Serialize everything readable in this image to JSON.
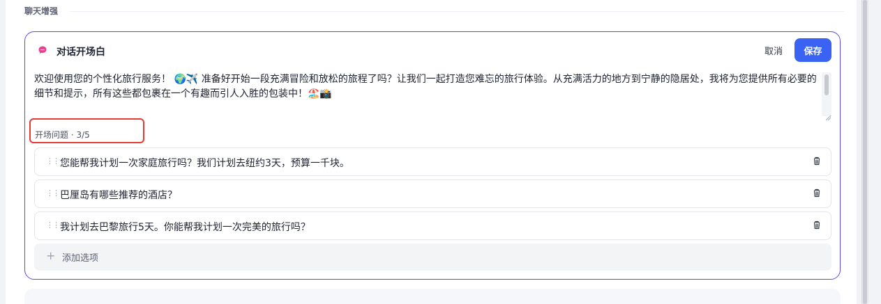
{
  "section": {
    "title": "聊天增强"
  },
  "card": {
    "title": "对话开场白",
    "cancel_label": "取消",
    "save_label": "保存",
    "intro_text": "欢迎使用您的个性化旅行服务！ 🌍✈️ 准备好开始一段充满冒险和放松的旅程了吗？让我们一起打造您难忘的旅行体验。从充满活力的地方到宁静的隐居处，我将为您提供所有必要的细节和提示，所有这些都包裹在一个有趣而引人入胜的包装中！🏖️📸",
    "questions_label": "开场问题 · 3/5",
    "questions": [
      {
        "text": "您能帮我计划一次家庭旅行吗？我们计划去纽约3天，预算一千块。"
      },
      {
        "text": "巴厘岛有哪些推荐的酒店？"
      },
      {
        "text": "我计划去巴黎旅行5天。你能帮我计划一次完美的旅行吗？"
      }
    ],
    "add_option_label": "添加选项"
  },
  "colors": {
    "accent": "#3a63f4",
    "border_active": "#5b49e6",
    "highlight": "#e53935",
    "brand_icon": "#e83e8c"
  }
}
